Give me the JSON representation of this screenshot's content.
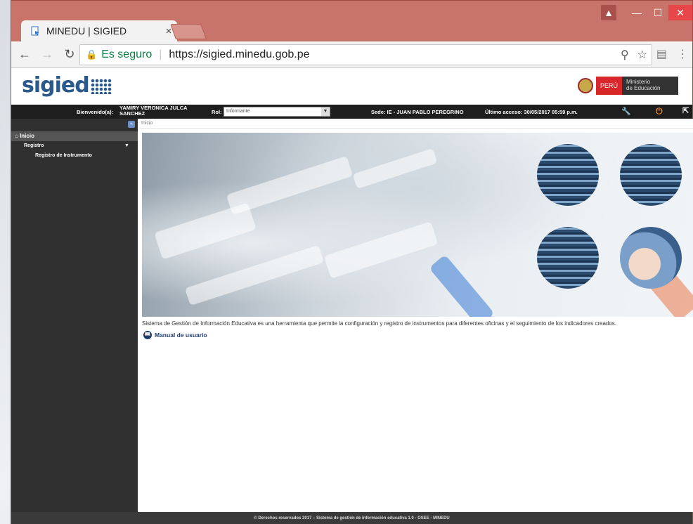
{
  "browser": {
    "tab_title": "MINEDU | SIGIED",
    "tab_close": "×",
    "secure_label": "Es seguro",
    "url": "https://sigied.minedu.gob.pe"
  },
  "header": {
    "logo_text": "sigied",
    "peru_label": "PERÚ",
    "ministry_label_1": "Ministerio",
    "ministry_label_2": "de Educación"
  },
  "infobar": {
    "welcome_label": "Bienvenido(a):",
    "user_name_1": "YAMIRY VERONICA JULCA",
    "user_name_2": "SANCHEZ",
    "rol_label": "Rol:",
    "rol_value": "Informante",
    "sede": "Sede: IE - JUAN PABLO PEREGRINO",
    "last_access": "Último acceso: 30/05/2017 05:59 p.m."
  },
  "sidebar": {
    "inicio": "Inicio",
    "registro": "Registro",
    "registro_instrumento": "Registro de Instrumento"
  },
  "content": {
    "breadcrumb": "Inicio",
    "description": "Sistema de Gestión de Información Educativa es una herramienta que permite la configuración y registro de instrumentos para diferentes oficinas y el seguimiento de los indicadores creados.",
    "manual_link": "Manual de usuario"
  },
  "footer": {
    "text": "© Derechos reservados 2017 – Sistema de gestión de información educativa 1.0 - OSEE - MINEDU"
  }
}
